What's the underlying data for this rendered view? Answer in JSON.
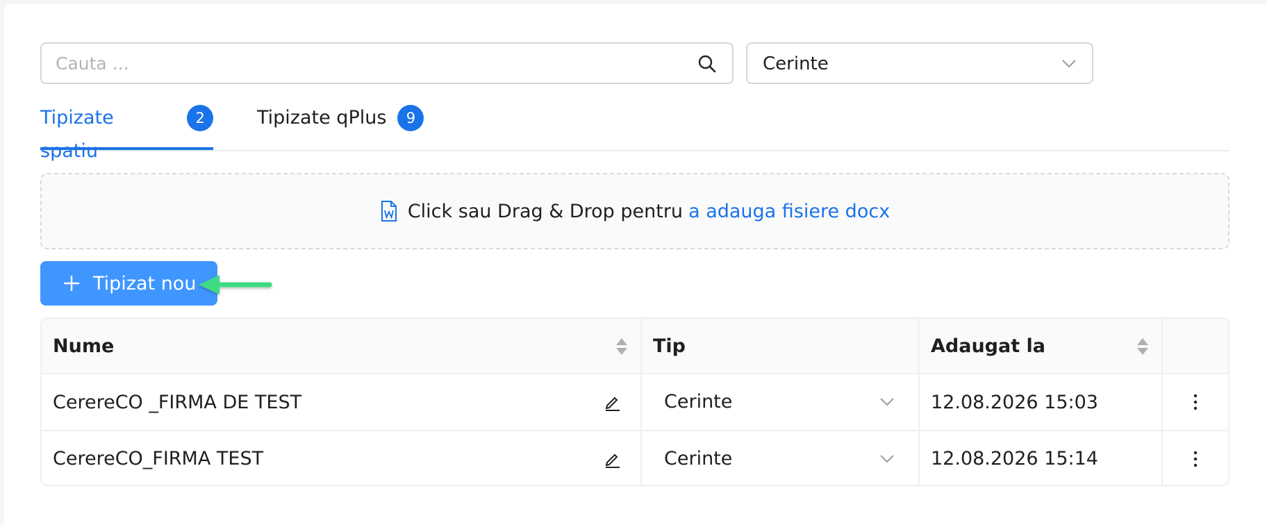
{
  "search": {
    "placeholder": "Cauta ...",
    "value": ""
  },
  "category_select": {
    "value": "Cerinte"
  },
  "tabs": [
    {
      "label": "Tipizate spatiu",
      "count": "2",
      "active": true
    },
    {
      "label": "Tipizate qPlus",
      "count": "9",
      "active": false
    }
  ],
  "dropzone": {
    "text": "Click sau Drag & Drop pentru",
    "link": "a adauga fisiere docx"
  },
  "new_button": {
    "label": "Tipizat nou"
  },
  "table": {
    "headers": {
      "name": "Nume",
      "type": "Tip",
      "added": "Adaugat la"
    },
    "rows": [
      {
        "name": "CerereCO _FIRMA DE TEST",
        "type": "Cerinte",
        "added": "12.08.2026 15:03"
      },
      {
        "name": "CerereCO_FIRMA TEST",
        "type": "Cerinte",
        "added": "12.08.2026 15:14"
      }
    ]
  },
  "colors": {
    "accent": "#1a73e8",
    "button": "#4096ff",
    "annotation_arrow": "#3ddc84"
  },
  "icons": {
    "search": "search-icon",
    "chevron": "chevron-down-icon",
    "document": "word-document-icon",
    "plus": "plus-icon",
    "sort": "sort-icon",
    "edit": "edit-icon",
    "more": "more-vertical-icon"
  }
}
